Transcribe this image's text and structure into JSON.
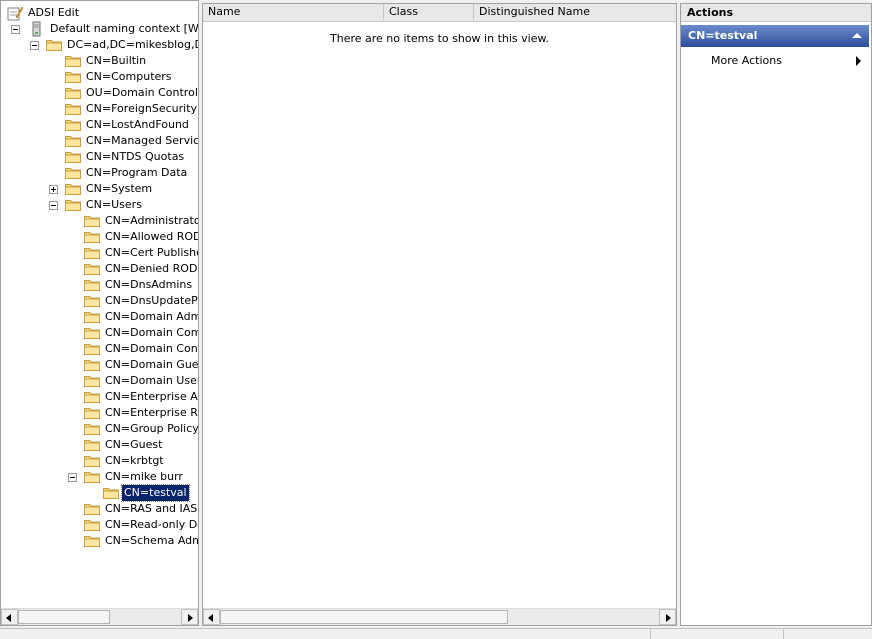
{
  "tree": {
    "root_label": "ADSI Edit",
    "nodes": [
      {
        "label": "Default naming context [WIN-U",
        "depth": 1,
        "expander": "minus",
        "icon": "server-icon"
      },
      {
        "label": "DC=ad,DC=mikesblog,DC=",
        "depth": 2,
        "expander": "minus",
        "icon": "folder-icon"
      },
      {
        "label": "CN=Builtin",
        "depth": 3,
        "expander": "none",
        "icon": "folder-icon"
      },
      {
        "label": "CN=Computers",
        "depth": 3,
        "expander": "none",
        "icon": "folder-icon"
      },
      {
        "label": "OU=Domain Controllers",
        "depth": 3,
        "expander": "none",
        "icon": "folder-icon"
      },
      {
        "label": "CN=ForeignSecurityPrin",
        "depth": 3,
        "expander": "none",
        "icon": "folder-icon"
      },
      {
        "label": "CN=LostAndFound",
        "depth": 3,
        "expander": "none",
        "icon": "folder-icon"
      },
      {
        "label": "CN=Managed Service A",
        "depth": 3,
        "expander": "none",
        "icon": "folder-icon"
      },
      {
        "label": "CN=NTDS Quotas",
        "depth": 3,
        "expander": "none",
        "icon": "folder-icon"
      },
      {
        "label": "CN=Program Data",
        "depth": 3,
        "expander": "none",
        "icon": "folder-icon"
      },
      {
        "label": "CN=System",
        "depth": 3,
        "expander": "plus",
        "icon": "folder-icon"
      },
      {
        "label": "CN=Users",
        "depth": 3,
        "expander": "minus",
        "icon": "folder-icon"
      },
      {
        "label": "CN=Administrator",
        "depth": 4,
        "expander": "none",
        "icon": "folder-icon"
      },
      {
        "label": "CN=Allowed RODC",
        "depth": 4,
        "expander": "none",
        "icon": "folder-icon"
      },
      {
        "label": "CN=Cert Publishers",
        "depth": 4,
        "expander": "none",
        "icon": "folder-icon"
      },
      {
        "label": "CN=Denied RODC P",
        "depth": 4,
        "expander": "none",
        "icon": "folder-icon"
      },
      {
        "label": "CN=DnsAdmins",
        "depth": 4,
        "expander": "none",
        "icon": "folder-icon"
      },
      {
        "label": "CN=DnsUpdateProx",
        "depth": 4,
        "expander": "none",
        "icon": "folder-icon"
      },
      {
        "label": "CN=Domain Admins",
        "depth": 4,
        "expander": "none",
        "icon": "folder-icon"
      },
      {
        "label": "CN=Domain Compu",
        "depth": 4,
        "expander": "none",
        "icon": "folder-icon"
      },
      {
        "label": "CN=Domain Contro",
        "depth": 4,
        "expander": "none",
        "icon": "folder-icon"
      },
      {
        "label": "CN=Domain Guests",
        "depth": 4,
        "expander": "none",
        "icon": "folder-icon"
      },
      {
        "label": "CN=Domain Users",
        "depth": 4,
        "expander": "none",
        "icon": "folder-icon"
      },
      {
        "label": "CN=Enterprise Adm",
        "depth": 4,
        "expander": "none",
        "icon": "folder-icon"
      },
      {
        "label": "CN=Enterprise Rea",
        "depth": 4,
        "expander": "none",
        "icon": "folder-icon"
      },
      {
        "label": "CN=Group Policy Cr",
        "depth": 4,
        "expander": "none",
        "icon": "folder-icon"
      },
      {
        "label": "CN=Guest",
        "depth": 4,
        "expander": "none",
        "icon": "folder-icon"
      },
      {
        "label": "CN=krbtgt",
        "depth": 4,
        "expander": "none",
        "icon": "folder-icon"
      },
      {
        "label": "CN=mike burr",
        "depth": 4,
        "expander": "minus",
        "icon": "folder-icon"
      },
      {
        "label": "CN=testval",
        "depth": 5,
        "expander": "none",
        "icon": "folder-icon",
        "selected": true
      },
      {
        "label": "CN=RAS and IAS S",
        "depth": 4,
        "expander": "none",
        "icon": "folder-icon"
      },
      {
        "label": "CN=Read-only Dom",
        "depth": 4,
        "expander": "none",
        "icon": "folder-icon"
      },
      {
        "label": "CN=Schema Admins",
        "depth": 4,
        "expander": "none",
        "icon": "folder-icon"
      }
    ]
  },
  "list": {
    "columns": [
      {
        "label": "Name"
      },
      {
        "label": "Class"
      },
      {
        "label": "Distinguished Name"
      }
    ],
    "empty_message": "There are no items to show in this view."
  },
  "actions": {
    "title": "Actions",
    "selected_item": "CN=testval",
    "items": [
      {
        "label": "More Actions"
      }
    ]
  },
  "colors": {
    "selection": "#0a246a",
    "actions_header_top": "#6b8ccc",
    "actions_header_bottom": "#2d4e9c",
    "folder": "#f4d677"
  }
}
